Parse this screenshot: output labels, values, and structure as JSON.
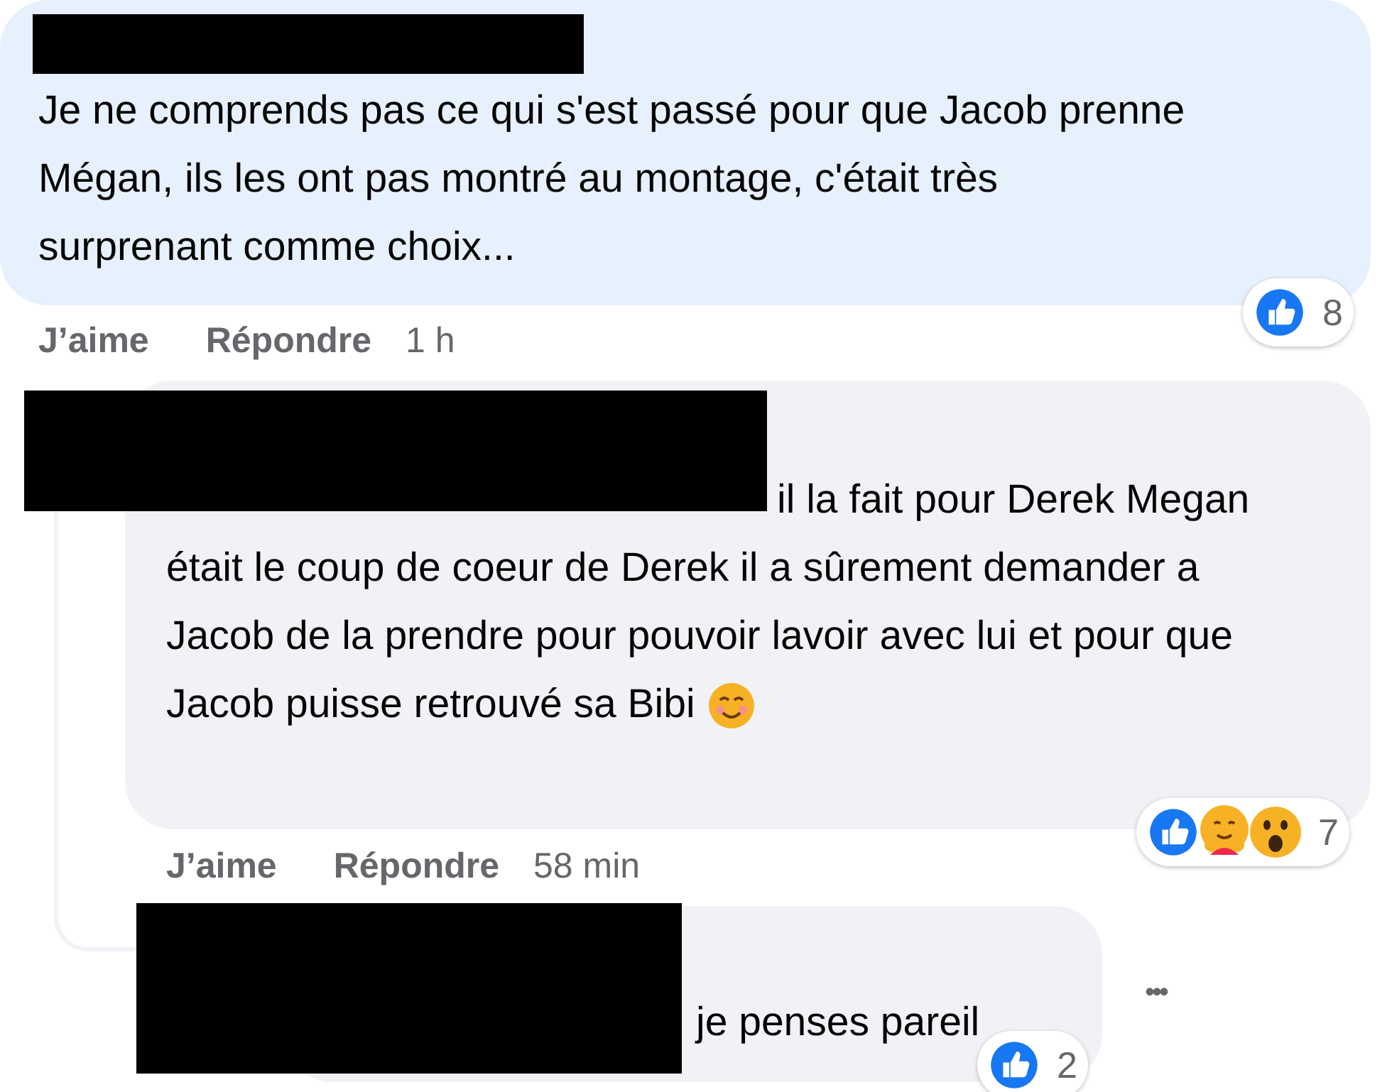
{
  "comments": [
    {
      "kind": "top",
      "author_redacted": true,
      "text": "Je ne comprends pas ce qui s'est passé pour que Jacob prenne Mégan, ils les ont pas montré au montage, c'était très surprenant comme choix...",
      "reactions": [
        {
          "kind": "like"
        }
      ],
      "reaction_count": "8",
      "actions": [
        "J’aime",
        "Répondre"
      ],
      "time": "1 h"
    },
    {
      "kind": "reply",
      "author_redacted": true,
      "text": "il la fait pour Derek Megan était le coup de coeur de Derek il a sûrement demander a Jacob de la prendre pour pouvoir lavoir avec lui et pour que Jacob puisse retrouvé sa Bibi",
      "emoji": true,
      "reactions": [
        {
          "kind": "like"
        },
        {
          "kind": "care"
        },
        {
          "kind": "wow"
        }
      ],
      "reaction_count": "7",
      "actions": [
        "J’aime",
        "Répondre"
      ],
      "time": "58 min"
    },
    {
      "kind": "nested",
      "author_redacted": true,
      "text": "je penses pareil",
      "reactions": [
        {
          "kind": "like"
        }
      ],
      "reaction_count": "2",
      "more_menu": "•••"
    }
  ]
}
